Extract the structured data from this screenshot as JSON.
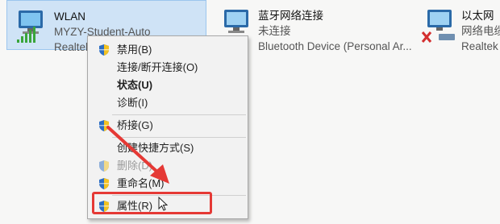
{
  "adapters": [
    {
      "name": "WLAN",
      "status": "MYZY-Student-Auto",
      "device": "Realtek",
      "icon": "wifi-signal-icon"
    },
    {
      "name": "蓝牙网络连接",
      "status": "未连接",
      "device": "Bluetooth Device (Personal Ar...",
      "icon": "computer-network-icon"
    },
    {
      "name": "以太网",
      "status": "网络电缆",
      "device": "Realtek",
      "icon": "ethernet-disconnected-icon"
    }
  ],
  "context_menu": {
    "items": [
      {
        "label": "禁用(B)",
        "shield": true
      },
      {
        "label": "连接/断开连接(O)",
        "shield": false
      },
      {
        "label": "状态(U)",
        "shield": false,
        "bold": true
      },
      {
        "label": "诊断(I)",
        "shield": false
      },
      {
        "label": "桥接(G)",
        "shield": true
      },
      {
        "label": "创建快捷方式(S)",
        "shield": false
      },
      {
        "label": "删除(D)",
        "shield": true,
        "disabled": true
      },
      {
        "label": "重命名(M)",
        "shield": true
      },
      {
        "label": "属性(R)",
        "shield": true
      }
    ]
  },
  "annotation_color": "#e53935"
}
